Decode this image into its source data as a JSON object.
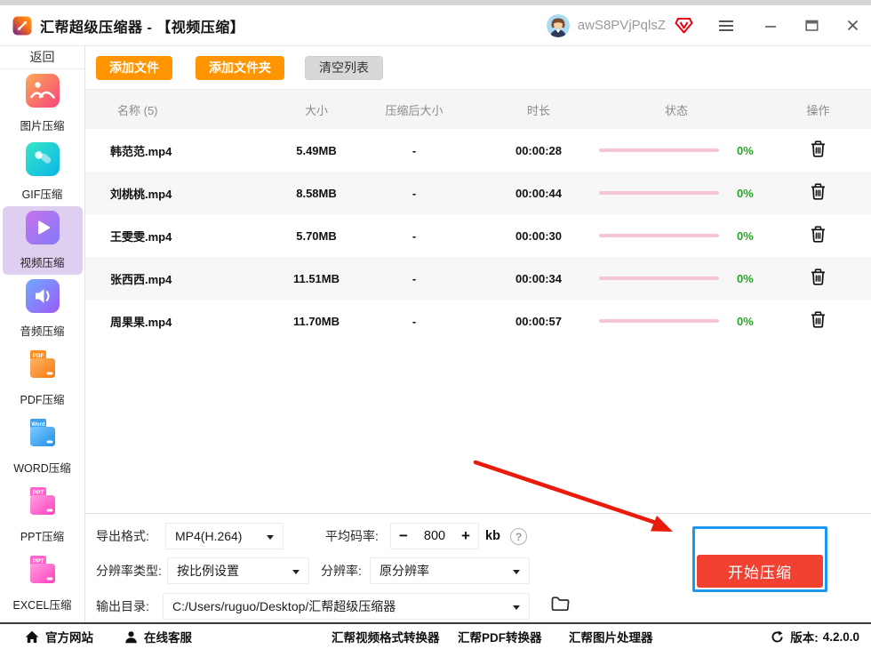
{
  "titlebar": {
    "app_title": "汇帮超级压缩器 - 【视频压缩】",
    "username": "awS8PVjPqlsZ"
  },
  "sidebar": {
    "back_label": "返回",
    "items": [
      {
        "label": "图片压缩"
      },
      {
        "label": "GIF压缩"
      },
      {
        "label": "视频压缩",
        "selected": true
      },
      {
        "label": "音频压缩"
      },
      {
        "label": "PDF压缩",
        "tag": "PDF"
      },
      {
        "label": "WORD压缩",
        "tag": "Word"
      },
      {
        "label": "PPT压缩",
        "tag": "PPT"
      },
      {
        "label": "EXCEL压缩",
        "tag": "PPT"
      }
    ]
  },
  "toolbar": {
    "add_file": "添加文件",
    "add_folder": "添加文件夹",
    "clear_list": "清空列表"
  },
  "table": {
    "headers": [
      "名称 (5)",
      "大小",
      "压缩后大小",
      "时长",
      "状态",
      "操作"
    ],
    "rows": [
      {
        "name": "韩范范.mp4",
        "size": "5.49MB",
        "compressed": "-",
        "duration": "00:00:28",
        "progress": "0%"
      },
      {
        "name": "刘桃桃.mp4",
        "size": "8.58MB",
        "compressed": "-",
        "duration": "00:00:44",
        "progress": "0%"
      },
      {
        "name": "王雯雯.mp4",
        "size": "5.70MB",
        "compressed": "-",
        "duration": "00:00:30",
        "progress": "0%"
      },
      {
        "name": "张西西.mp4",
        "size": "11.51MB",
        "compressed": "-",
        "duration": "00:00:34",
        "progress": "0%"
      },
      {
        "name": "周果果.mp4",
        "size": "11.70MB",
        "compressed": "-",
        "duration": "00:00:57",
        "progress": "0%"
      }
    ]
  },
  "settings": {
    "export_format_label": "导出格式:",
    "export_format_value": "MP4(H.264)",
    "bitrate_label": "平均码率:",
    "bitrate_minus": "−",
    "bitrate_value": "800",
    "bitrate_plus": "+",
    "bitrate_unit": "kb",
    "help_glyph": "?",
    "resolution_type_label": "分辨率类型:",
    "resolution_type_value": "按比例设置",
    "resolution_label": "分辨率:",
    "resolution_value": "原分辨率",
    "output_dir_label": "输出目录:",
    "output_dir_value": "C:/Users/ruguo/Desktop/汇帮超级压缩器",
    "start_button": "开始压缩"
  },
  "footer": {
    "official_site": "官方网站",
    "online_service": "在线客服",
    "links": [
      "汇帮视频格式转换器",
      "汇帮PDF转换器",
      "汇帮图片处理器"
    ],
    "version_label": "版本:",
    "version_value": "4.2.0.0"
  },
  "colors": {
    "accent_orange": "#FF9502",
    "button_gray": "#D8D8D8",
    "start_red": "#F24130",
    "highlight_blue": "#1E97F3",
    "progress_pink": "#F6C6D7",
    "percent_green": "#2AA32A",
    "selected_purple": "#DECFF1",
    "arrow_red": "#EA1B0B"
  },
  "icons": {
    "app-logo-icon": "compress-diagonal-arrows",
    "avatar": "user-portrait",
    "vip-badge-icon": "red-gem-v",
    "menu-icon": "hamburger-lines",
    "minimize-icon": "horizontal-line",
    "maximize-icon": "square-outline",
    "close-icon": "cross",
    "chevron-down-icon": "down-triangle",
    "trash-icon": "trash-can-outline",
    "help-icon": "question-circle",
    "browse-folder-icon": "folder-outline",
    "home-icon": "house",
    "service-icon": "person-bust",
    "refresh-icon": "circular-arrow"
  }
}
